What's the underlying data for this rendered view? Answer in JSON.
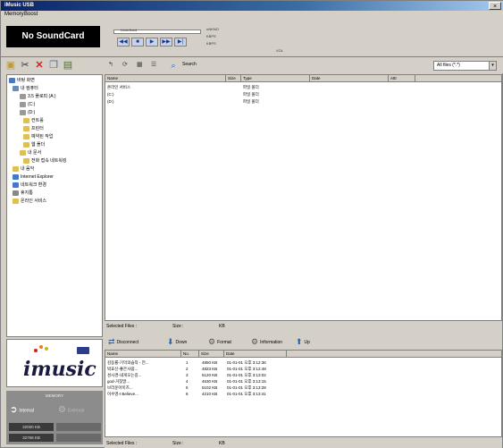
{
  "window": {
    "title": "iMusic USB",
    "close_label": "×"
  },
  "menu": {
    "items": [
      "Memory",
      "Boost"
    ]
  },
  "player": {
    "display": "No SoundCard",
    "seek_label": "Undefined",
    "buttons": [
      "◀◀",
      "■",
      "▶",
      "▶▶",
      "▶|"
    ],
    "info": [
      "uNKNO",
      "KBPS",
      "KBPS"
    ],
    "volume_label": "VOL"
  },
  "toolbar": {
    "search_label": "Search",
    "filter_value": "All files (*.*)"
  },
  "tree": {
    "items": [
      {
        "label": "바탕 화면",
        "color": "#4a78c8"
      },
      {
        "label": "내 컴퓨터",
        "color": "#6b8bb8"
      },
      {
        "label": "3.5 플로피 (A:)",
        "color": "#999999"
      },
      {
        "label": "(C:)",
        "color": "#999999"
      },
      {
        "label": "(D:)",
        "color": "#999999"
      },
      {
        "label": "컨트롤",
        "color": "#e0c050"
      },
      {
        "label": "프린터",
        "color": "#e0c050"
      },
      {
        "label": "예약된 작업",
        "color": "#e0c050"
      },
      {
        "label": "웹 폴더",
        "color": "#e0c050"
      },
      {
        "label": "내 문서",
        "color": "#e0c050"
      },
      {
        "label": "전화 접속 네트워킹",
        "color": "#e0c050"
      },
      {
        "label": "내 음악",
        "color": "#e0c050"
      },
      {
        "label": "Internet Explorer",
        "color": "#3a7cd0"
      },
      {
        "label": "네트워크 환경",
        "color": "#4a78c8"
      },
      {
        "label": "휴지통",
        "color": "#888888"
      },
      {
        "label": "온라인 서비스",
        "color": "#e0c050"
      }
    ]
  },
  "filelist": {
    "columns": [
      "Name",
      "Size",
      "Type",
      "Date",
      "Attr"
    ],
    "rows": [
      {
        "name": "온라인 서비스",
        "size": "",
        "type": "파일 폴더"
      },
      {
        "name": "(C:)",
        "size": "",
        "type": "파일 폴더"
      },
      {
        "name": "(D:)",
        "size": "",
        "type": "파일 폴더"
      }
    ]
  },
  "status_top": {
    "selected_label": "Selected Files :",
    "size_label": "Size :",
    "unit": "KB"
  },
  "lower_toolbar": {
    "items": [
      "Disconnect",
      "Down",
      "Format",
      "Information",
      "Up"
    ]
  },
  "lower_list": {
    "columns": [
      "Name",
      "No.",
      "Size",
      "Date"
    ],
    "rows": [
      {
        "name": "김동률-기억의습작 - 전...",
        "no": "1",
        "size": "4850 KB",
        "date": "01-01-01 오후 3:12:36"
      },
      {
        "name": "박효신-좋은사람...",
        "no": "2",
        "size": "4823 KB",
        "date": "01-01-01 오후 3:12:48"
      },
      {
        "name": "성시경-내게오는길...",
        "no": "3",
        "size": "5120 KB",
        "date": "01-01-01 오후 3:13:02"
      },
      {
        "name": "god-거짓말...",
        "no": "4",
        "size": "4630 KB",
        "date": "01-01-01 오후 3:13:15"
      },
      {
        "name": "브라운아이즈...",
        "no": "5",
        "size": "5102 KB",
        "date": "01-01-01 오후 3:13:28"
      },
      {
        "name": "이수영-I Believe...",
        "no": "6",
        "size": "4210 KB",
        "date": "01-01-01 오후 3:13:41"
      }
    ]
  },
  "logo": {
    "brand": "music",
    "brand_i": "i"
  },
  "memory": {
    "label": "MEMORY",
    "internal_label": "Internal",
    "external_label": "External",
    "size1": "32000 KB",
    "size2": "32768 KB"
  },
  "status_bottom": {
    "selected_label": "Selected Files :",
    "size_label": "Size :",
    "unit": "KB"
  }
}
